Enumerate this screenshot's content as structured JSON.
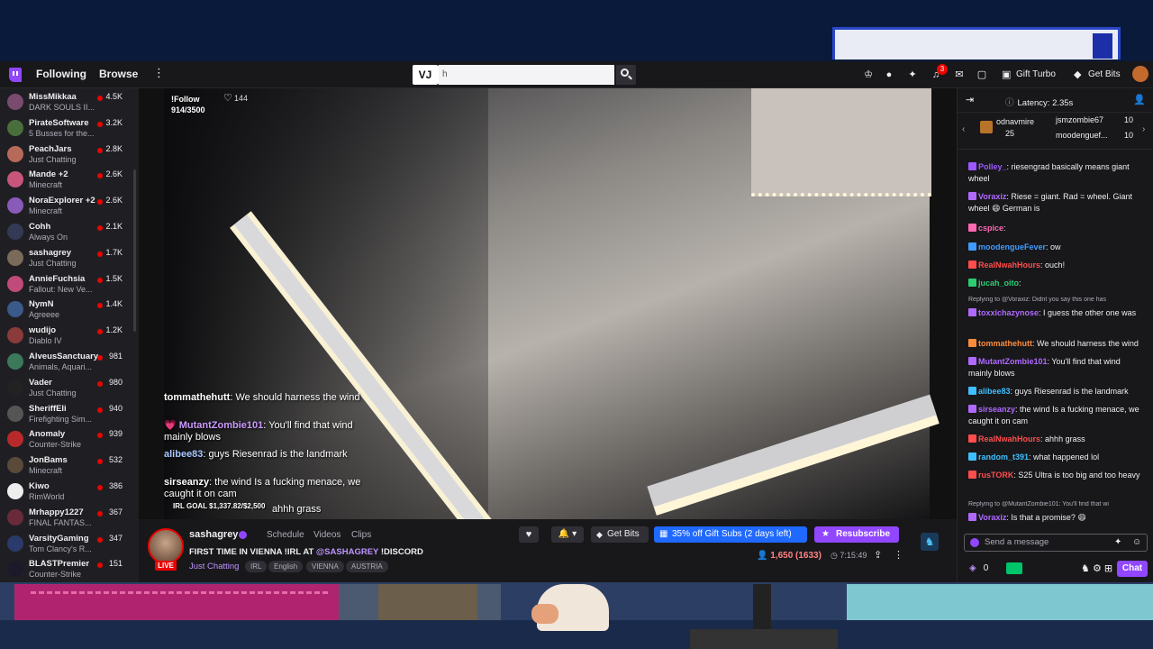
{
  "nav": {
    "following": "Following",
    "browse": "Browse",
    "more": "⋮",
    "search_logo": "VJ",
    "search_placeholder": "h",
    "notifications": "3",
    "gift_turbo": "Gift Turbo",
    "get_bits": "Get Bits"
  },
  "sidebar": {
    "items": [
      {
        "name": "MissMikkaa",
        "game": "DARK SOULS II...",
        "viewers": "4.5K",
        "color": "#7a4b6e"
      },
      {
        "name": "PirateSoftware",
        "game": "5 Busses for the...",
        "viewers": "3.2K",
        "color": "#4a6e3b"
      },
      {
        "name": "PeachJars",
        "game": "Just Chatting",
        "viewers": "2.8K",
        "color": "#b86a5a"
      },
      {
        "name": "Mande +2",
        "game": "Minecraft",
        "viewers": "2.6K",
        "color": "#c7567a"
      },
      {
        "name": "NoraExplorer +2",
        "game": "Minecraft",
        "viewers": "2.6K",
        "color": "#8a5ab8"
      },
      {
        "name": "Cohh",
        "game": "Always On",
        "viewers": "2.1K",
        "color": "#333a55"
      },
      {
        "name": "sashagrey",
        "game": "Just Chatting",
        "viewers": "1.7K",
        "color": "#7a6a5a"
      },
      {
        "name": "AnnieFuchsia",
        "game": "Fallout: New Ve...",
        "viewers": "1.5K",
        "color": "#c04a7a"
      },
      {
        "name": "NymN",
        "game": "Agreeee",
        "viewers": "1.4K",
        "color": "#3a5a8a"
      },
      {
        "name": "wudijo",
        "game": "Diablo IV",
        "viewers": "1.2K",
        "color": "#8a3a3a"
      },
      {
        "name": "AlveusSanctuary",
        "game": "Animals, Aquari...",
        "viewers": "981",
        "color": "#3a7a5a"
      },
      {
        "name": "Vader",
        "game": "Just Chatting",
        "viewers": "980",
        "color": "#222"
      },
      {
        "name": "SheriffEli",
        "game": "Firefighting Sim...",
        "viewers": "940",
        "color": "#555"
      },
      {
        "name": "Anomaly",
        "game": "Counter-Strike",
        "viewers": "939",
        "color": "#b82a2a"
      },
      {
        "name": "JonBams",
        "game": "Minecraft",
        "viewers": "532",
        "color": "#5a4a3a"
      },
      {
        "name": "Kiwo",
        "game": "RimWorld",
        "viewers": "386",
        "color": "#eee"
      },
      {
        "name": "Mrhappy1227",
        "game": "FINAL FANTAS...",
        "viewers": "367",
        "color": "#6a2a3a"
      },
      {
        "name": "VarsityGaming",
        "game": "Tom Clancy's R...",
        "viewers": "347",
        "color": "#2a3a6a"
      },
      {
        "name": "BLASTPremier",
        "game": "Counter-Strike",
        "viewers": "151",
        "color": "#1a1a2a"
      }
    ]
  },
  "video": {
    "follow_label": "!Follow",
    "follow_progress": "914/3500",
    "follow_count": "144",
    "chat": [
      {
        "user": "tommathehutt",
        "text": "We should harness the wind"
      },
      {
        "user": "MutantZombie101",
        "text": "You'll find that wind mainly blows"
      },
      {
        "user": "alibee83",
        "text": "guys Riesenrad is the landmark"
      },
      {
        "user": "sirseanzy",
        "text": "the wind Is a fucking menace, we caught it on cam"
      }
    ],
    "irl_goal": "IRL GOAL $1,337.82/$2,500",
    "goal_overlap": "ahhh grass"
  },
  "stream": {
    "streamer": "sashagrey",
    "live": "LIVE",
    "tabs": [
      "Schedule",
      "Videos",
      "Clips"
    ],
    "title_pre": "FIRST TIME IN VIENNA !IRL AT ",
    "title_mention": "@SASHAGREY",
    "title_post": " !DISCORD",
    "category": "Just Chatting",
    "tags": [
      "IRL",
      "English",
      "VIENNA",
      "AUSTRIA"
    ],
    "get_bits": "Get Bits",
    "gift_subs": "35% off Gift Subs (2 days left)",
    "resubscribe": "Resubscribe",
    "viewers": "1,650 (1633)",
    "uptime": "7:15:49"
  },
  "chat": {
    "latency": "Latency: 2.35s",
    "hype": [
      {
        "name": "odnavmire",
        "num": "25"
      },
      {
        "name": "jsmzombie67",
        "num": "10"
      },
      {
        "name": "moodenguef...",
        "num": "10"
      }
    ],
    "messages": [
      {
        "user": "Polley_",
        "text": "riesengrad basically means giant wheel",
        "color": "#9b59ff"
      },
      {
        "user": "Voraxiz",
        "text": "Riese = giant. Rad = wheel. Giant wheel 😄 German is",
        "color": "#b069ff"
      },
      {
        "user": "cspice",
        "text": "",
        "color": "#ff69b4"
      },
      {
        "user": "moodengueFever",
        "text": "ow",
        "color": "#3f9bff"
      },
      {
        "user": "RealNwahHours",
        "text": "ouch!",
        "color": "#ff4d4d"
      },
      {
        "user": "jucah_oito",
        "text": "",
        "color": "#2ecc71"
      },
      {
        "user": "toxxichazynose",
        "text": "I guess the other one was",
        "color": "#b069ff"
      },
      {
        "user": "tommathehutt",
        "text": "We should harness the wind",
        "color": "#ff8c3a"
      },
      {
        "user": "MutantZombie101",
        "text": "You'll find that wind mainly blows",
        "color": "#b069ff"
      },
      {
        "user": "alibee83",
        "text": "guys Riesenrad is the landmark",
        "color": "#3fbfff"
      },
      {
        "user": "sirseanzy",
        "text": "the wind Is a fucking menace, we caught it on cam",
        "color": "#b069ff"
      },
      {
        "user": "RealNwahHours",
        "text": "ahhh grass",
        "color": "#ff4d4d"
      },
      {
        "user": "random_t391",
        "text": "what happened lol",
        "color": "#3fbfff"
      },
      {
        "user": "rusTORK",
        "text": "S25 Ultra is too big and too heavy",
        "color": "#ff4d4d"
      },
      {
        "user": "Voraxiz",
        "text": "Is that a promise? 😄",
        "color": "#b069ff"
      }
    ],
    "reply1": "Replying to @Voraxiz: Didnt you say this one has",
    "reply2": "Replying to @MutantZombie101: You'll find that wi",
    "input_placeholder": "Send a message",
    "points": "0",
    "chat_button": "Chat"
  }
}
